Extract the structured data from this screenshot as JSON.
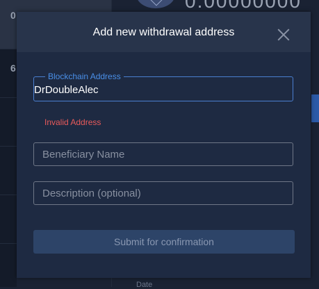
{
  "background": {
    "rows": [
      "0",
      "6"
    ],
    "balance_text": "0.00000000",
    "footer_text": "Date"
  },
  "modal": {
    "title": "Add new withdrawal address",
    "address_field": {
      "label": "Blockchain Address",
      "value": "DrDoubleAlec",
      "error": "Invalid Address"
    },
    "beneficiary_field": {
      "placeholder": "Beneficiary Name"
    },
    "description_field": {
      "placeholder": "Description (optional)"
    },
    "submit_label": "Submit for confirmation"
  },
  "colors": {
    "modal_bg": "#1e2a42",
    "header_bg": "#28344b",
    "accent": "#4a8fe8",
    "error": "#e85a5a",
    "button_bg": "#2d4468"
  }
}
